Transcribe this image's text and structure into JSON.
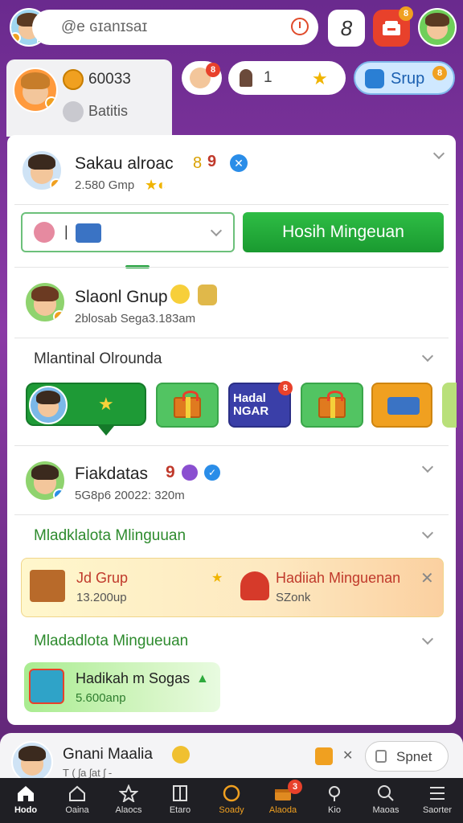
{
  "topbar": {
    "search_text": "@e ɢɪanɪsaɪ",
    "account_initial": "8",
    "notif_count": "8"
  },
  "profile_card": {
    "coin_value": "60033",
    "label": "Batitis"
  },
  "chips": {
    "chip1_badge": "8",
    "chip2_count": "1",
    "chip3_label": "Srup",
    "chip3_badge": "8"
  },
  "user1": {
    "name": "Sakau alroac",
    "level_num": "8",
    "level_badge": "9",
    "sub": "2.580 Gmp"
  },
  "action": {
    "button_label": "Hosih Mingeuan",
    "dropdown_value": "|"
  },
  "user2": {
    "name": "Slaonl Gnup",
    "sub": "2blosab Sega3.183am"
  },
  "section1": {
    "title": "Mlantinal Olrounda"
  },
  "gift_tile_text": "Hadal NGAR",
  "gift_tile_badge": "8",
  "user3": {
    "name": "Fiakdatas",
    "level": "9",
    "sub": "5G8p6 20022: 320m"
  },
  "section2": {
    "title": "Mladklalota Mlinguuan"
  },
  "promo": {
    "left_title": "Jd Grup",
    "left_sub": "13.200up",
    "right_title": "Hadiiah Minguenan",
    "right_sub": "SZonk"
  },
  "section3": {
    "title": "Mladadlota Mingueuan"
  },
  "reward": {
    "title": "Hadikah m Sogas",
    "sub": "5.600anp"
  },
  "sheet": {
    "name": "Gnani Maalia",
    "sub": "T  (  ʃa  ʃat  ʃ  -",
    "button": "Spnet"
  },
  "nav": [
    {
      "label": "Hodo"
    },
    {
      "label": "Oaina"
    },
    {
      "label": "Alaocs"
    },
    {
      "label": "Etaro"
    },
    {
      "label": "Soady"
    },
    {
      "label": "Alaoda"
    },
    {
      "label": "Kio"
    },
    {
      "label": "Maoas"
    },
    {
      "label": "Saorter"
    }
  ],
  "nav_badge": "3",
  "colors": {
    "green": "#23a33a",
    "purple_bg": "#7a2f9a",
    "accent_orange": "#f0a020",
    "nav_active": "#ffffff",
    "nav_orange": "#f0a020"
  }
}
